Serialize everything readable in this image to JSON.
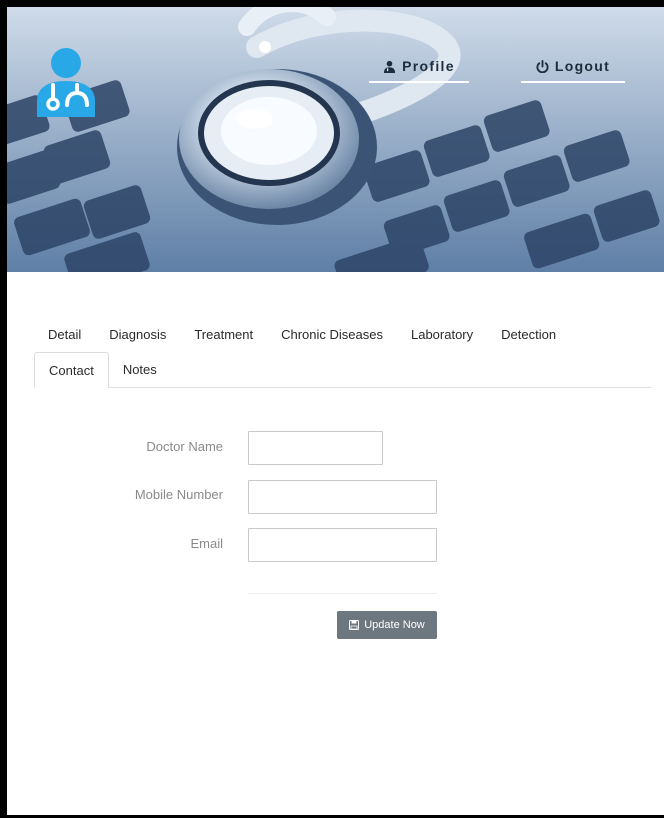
{
  "header": {
    "nav": {
      "profile_label": "Profile",
      "logout_label": "Logout"
    },
    "icons": {
      "logo": "doctor-stethoscope-icon",
      "profile": "user-doctor-icon",
      "logout": "power-icon"
    }
  },
  "tabs": {
    "row1": [
      "Detail",
      "Diagnosis",
      "Treatment",
      "Chronic Diseases",
      "Laboratory",
      "Detection"
    ],
    "row2": [
      "Contact",
      "Notes"
    ],
    "active": "Contact"
  },
  "form": {
    "doctor_name": {
      "label": "Doctor Name",
      "value": ""
    },
    "mobile_number": {
      "label": "Mobile Number",
      "value": ""
    },
    "email": {
      "label": "Email",
      "value": ""
    },
    "submit_label": "Update Now",
    "submit_icon": "floppy-save-icon"
  },
  "colors": {
    "logo_blue": "#29a8e8",
    "button_bg": "#6d7780",
    "nav_underline": "#ffffff"
  }
}
